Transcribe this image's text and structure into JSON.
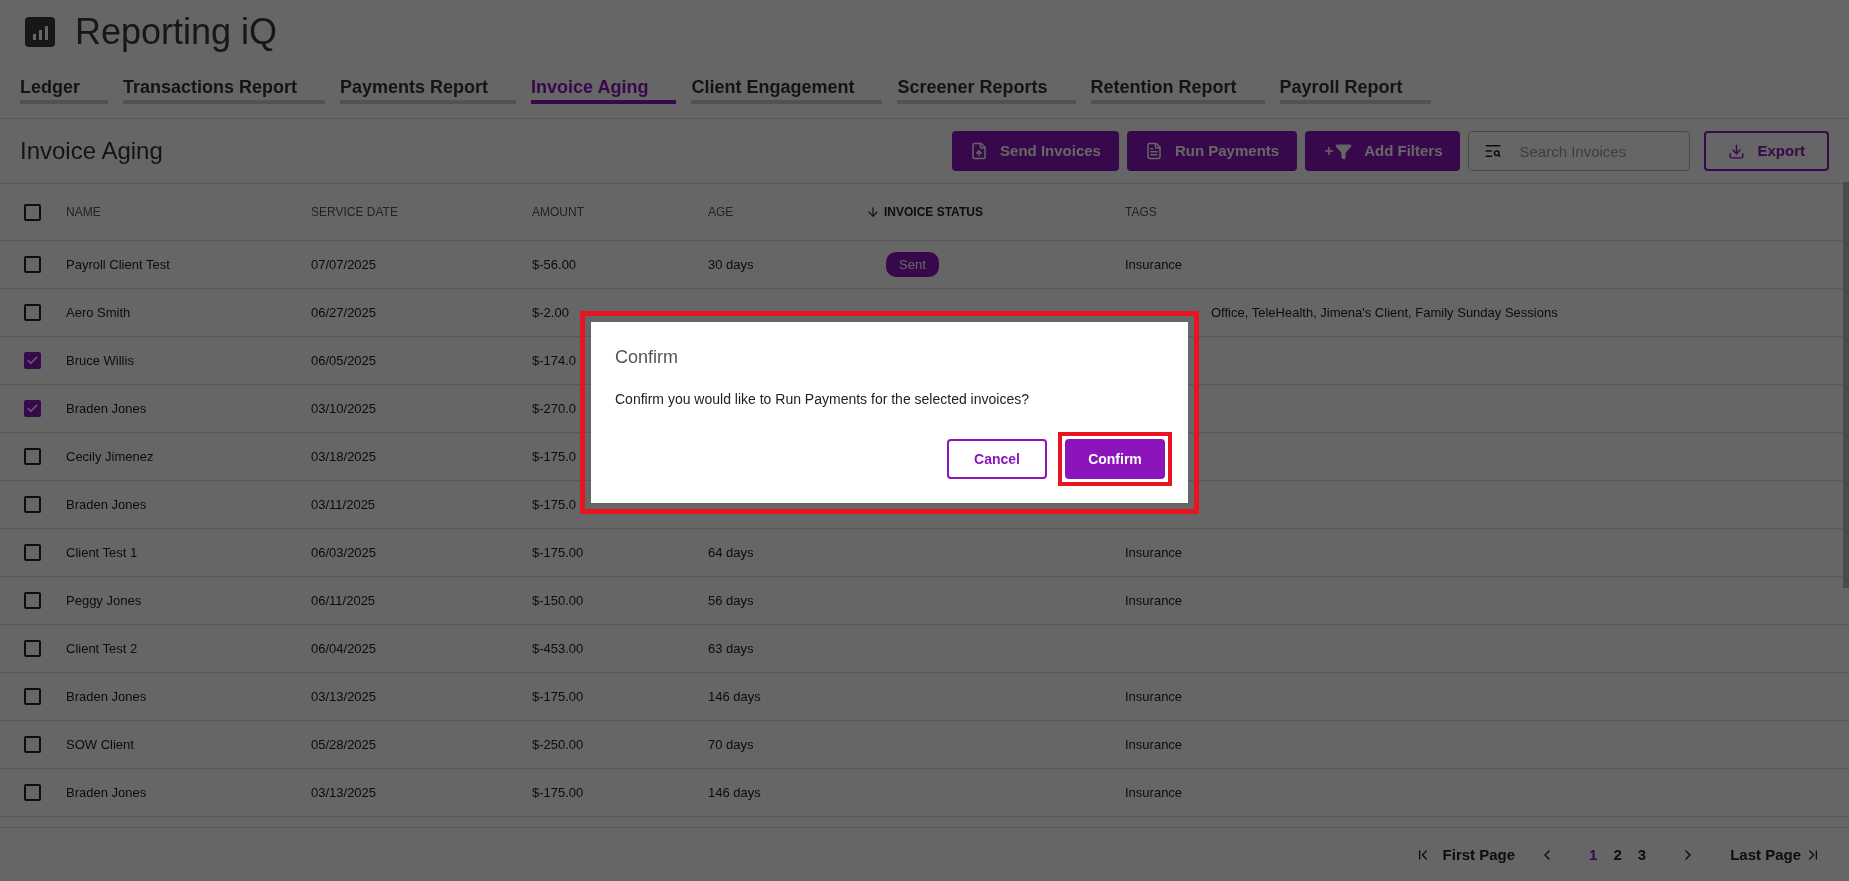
{
  "app": {
    "title": "Reporting iQ"
  },
  "tabs": [
    {
      "label": "Ledger",
      "selected": false
    },
    {
      "label": "Transactions Report",
      "selected": false
    },
    {
      "label": "Payments Report",
      "selected": false
    },
    {
      "label": "Invoice Aging",
      "selected": true
    },
    {
      "label": "Client Engagement",
      "selected": false
    },
    {
      "label": "Screener Reports",
      "selected": false
    },
    {
      "label": "Retention Report",
      "selected": false
    },
    {
      "label": "Payroll Report",
      "selected": false
    }
  ],
  "toolbar": {
    "title": "Invoice Aging",
    "buttons": [
      {
        "label": "Send Invoices",
        "kind": "upload"
      },
      {
        "label": "Run Payments",
        "kind": "list"
      },
      {
        "label": "Add Filters",
        "kind": "filter"
      }
    ],
    "search": {
      "placeholder": "Search Invoices"
    },
    "export": "Export"
  },
  "table": {
    "select_all": {
      "checked": false
    },
    "columns": [
      {
        "label": "NAME",
        "sorted": false
      },
      {
        "label": "SERVICE DATE",
        "sorted": false
      },
      {
        "label": "AMOUNT",
        "sorted": false
      },
      {
        "label": "AGE",
        "sorted": false
      },
      {
        "label": "INVOICE STATUS",
        "sorted": true
      },
      {
        "label": "TAGS",
        "sorted": false
      }
    ],
    "rows": [
      {
        "checked": false,
        "name": "Payroll Client Test",
        "date": "07/07/2025",
        "amount": "$-56.00",
        "age": "30 days",
        "status": "Sent",
        "tags": "Insurance"
      },
      {
        "checked": false,
        "name": "Aero Smith",
        "date": "06/27/2025",
        "amount": "$-2.00",
        "tags": "Office, TeleHealth, Jimena's Client, Family Sunday Sessions"
      },
      {
        "checked": true,
        "name": "Bruce Willis",
        "date": "06/05/2025",
        "amount": "$-174.0"
      },
      {
        "checked": true,
        "name": "Braden Jones",
        "date": "03/10/2025",
        "amount": "$-270.0"
      },
      {
        "checked": false,
        "name": "Cecily Jimenez",
        "date": "03/18/2025",
        "amount": "$-175.0"
      },
      {
        "checked": false,
        "name": "Braden Jones",
        "date": "03/11/2025",
        "amount": "$-175.0"
      },
      {
        "checked": false,
        "name": "Client Test 1",
        "date": "06/03/2025",
        "amount": "$-175.00",
        "age": "64 days",
        "tags": "Insurance"
      },
      {
        "checked": false,
        "name": "Peggy Jones",
        "date": "06/11/2025",
        "amount": "$-150.00",
        "age": "56 days",
        "tags": "Insurance"
      },
      {
        "checked": false,
        "name": "Client Test 2",
        "date": "06/04/2025",
        "amount": "$-453.00",
        "age": "63 days"
      },
      {
        "checked": false,
        "name": "Braden Jones",
        "date": "03/13/2025",
        "amount": "$-175.00",
        "age": "146 days",
        "tags": "Insurance"
      },
      {
        "checked": false,
        "name": "SOW Client",
        "date": "05/28/2025",
        "amount": "$-250.00",
        "age": "70 days",
        "tags": "Insurance"
      },
      {
        "checked": false,
        "name": "Braden Jones",
        "date": "03/13/2025",
        "amount": "$-175.00",
        "age": "146 days",
        "tags": "Insurance"
      }
    ]
  },
  "pagination": {
    "first": "First Page",
    "last": "Last Page",
    "pages": [
      {
        "label": "1",
        "selected": true
      },
      {
        "label": "2",
        "selected": false
      },
      {
        "label": "3",
        "selected": false
      }
    ]
  },
  "dialog": {
    "title": "Confirm",
    "message": "Confirm you would like to Run Payments for the selected invoices?",
    "highlighted": true,
    "buttons": [
      {
        "label": "Cancel",
        "kind": "secondary",
        "highlighted": false
      },
      {
        "label": "Confirm",
        "kind": "primary",
        "highlighted": true
      }
    ]
  }
}
